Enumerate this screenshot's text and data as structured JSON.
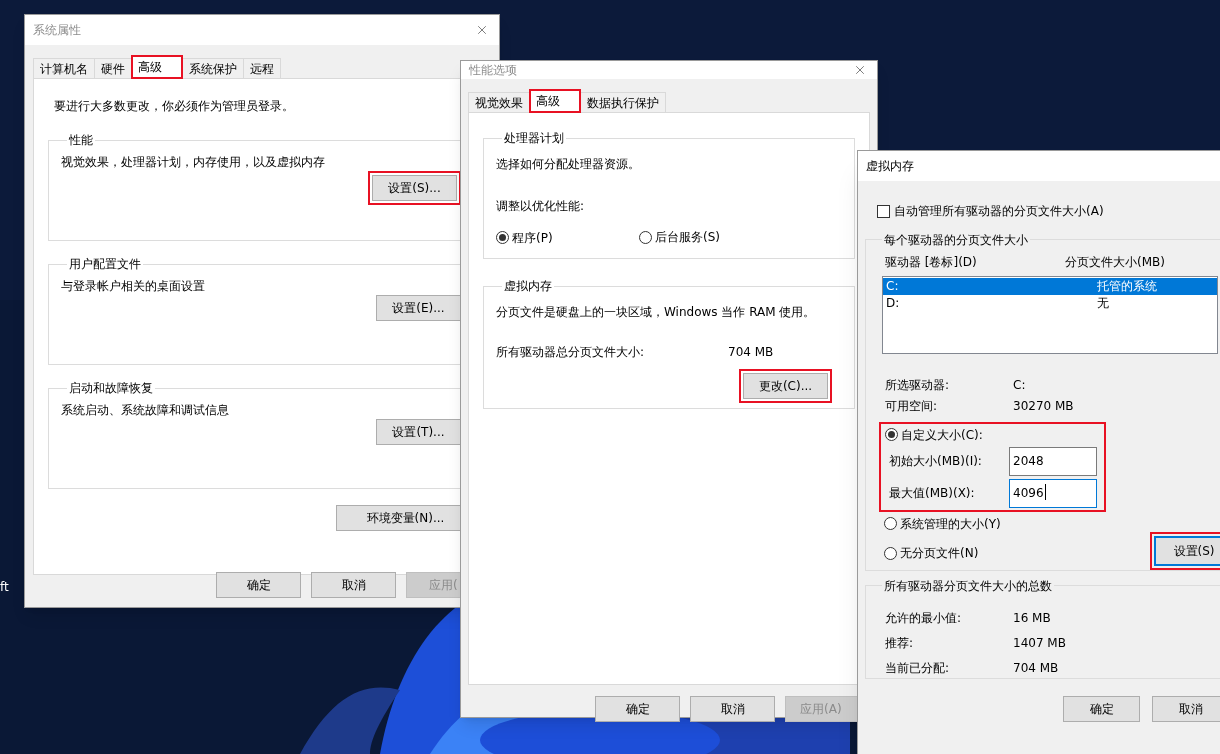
{
  "desktop": {
    "icon_label": "ft"
  },
  "system_properties": {
    "title": "系统属性",
    "close_button": true,
    "tabs": [
      {
        "label": "计算机名",
        "selected": false,
        "highlighted": false
      },
      {
        "label": "硬件",
        "selected": false,
        "highlighted": false
      },
      {
        "label": "高级",
        "selected": true,
        "highlighted": true
      },
      {
        "label": "系统保护",
        "selected": false,
        "highlighted": false
      },
      {
        "label": "远程",
        "selected": false,
        "highlighted": false
      }
    ],
    "notice": "要进行大多数更改，你必须作为管理员登录。",
    "groups": [
      {
        "title": "性能",
        "description": "视觉效果，处理器计划，内存使用，以及虚拟内存",
        "button": {
          "label": "设置(S)...",
          "highlighted": true
        }
      },
      {
        "title": "用户配置文件",
        "description": "与登录帐户相关的桌面设置",
        "button": {
          "label": "设置(E)...",
          "highlighted": false
        }
      },
      {
        "title": "启动和故障恢复",
        "description": "系统启动、系统故障和调试信息",
        "button": {
          "label": "设置(T)...",
          "highlighted": false
        }
      }
    ],
    "env_button": "环境变量(N)...",
    "buttons": [
      {
        "label": "确定",
        "disabled": false
      },
      {
        "label": "取消",
        "disabled": false
      },
      {
        "label": "应用(",
        "disabled": true
      }
    ]
  },
  "performance_options": {
    "title": "性能选项",
    "close_button": true,
    "tabs": [
      {
        "label": "视觉效果",
        "selected": false,
        "highlighted": false
      },
      {
        "label": "高级",
        "selected": true,
        "highlighted": true
      },
      {
        "label": "数据执行保护",
        "selected": false,
        "highlighted": false
      }
    ],
    "processor_group": {
      "title": "处理器计划",
      "description": "选择如何分配处理器资源。",
      "prompt": "调整以优化性能:",
      "options": [
        {
          "label": "程序(P)",
          "selected": true
        },
        {
          "label": "后台服务(S)",
          "selected": false
        }
      ]
    },
    "vm_group": {
      "title": "虚拟内存",
      "description": "分页文件是硬盘上的一块区域，Windows 当作 RAM 使用。",
      "total_label": "所有驱动器总分页文件大小:",
      "total_value": "704 MB",
      "button": {
        "label": "更改(C)...",
        "highlighted": true
      }
    },
    "buttons": [
      {
        "label": "确定",
        "disabled": false
      },
      {
        "label": "取消",
        "disabled": false
      },
      {
        "label": "应用(A)",
        "disabled": true
      }
    ]
  },
  "virtual_memory": {
    "title": "虚拟内存",
    "close_button": false,
    "auto_manage": {
      "label": "自动管理所有驱动器的分页文件大小(A)",
      "checked": false
    },
    "drives_group": {
      "title": "每个驱动器的分页文件大小",
      "columns": [
        "驱动器 [卷标](D)",
        "分页文件大小(MB)"
      ],
      "rows": [
        {
          "drive": "C:",
          "size": "托管的系统",
          "selected": true
        },
        {
          "drive": "D:",
          "size": "无",
          "selected": false
        }
      ],
      "info": [
        {
          "label": "所选驱动器:",
          "value": "C:"
        },
        {
          "label": "可用空间:",
          "value": "30270 MB"
        }
      ],
      "custom": {
        "label": "自定义大小(C):",
        "selected": true,
        "highlighted": true,
        "fields": [
          {
            "label": "初始大小(MB)(I):",
            "value": "2048",
            "focused": false
          },
          {
            "label": "最大值(MB)(X):",
            "value": "4096",
            "focused": true
          }
        ]
      },
      "options": [
        {
          "label": "系统管理的大小(Y)",
          "selected": false
        },
        {
          "label": "无分页文件(N)",
          "selected": false
        }
      ],
      "set_button": {
        "label": "设置(S)",
        "highlighted": true,
        "focused": true
      }
    },
    "totals_group": {
      "title": "所有驱动器分页文件大小的总数",
      "rows": [
        {
          "label": "允许的最小值:",
          "value": "16 MB"
        },
        {
          "label": "推荐:",
          "value": "1407 MB"
        },
        {
          "label": "当前已分配:",
          "value": "704 MB"
        }
      ]
    },
    "buttons": [
      {
        "label": "确定",
        "disabled": false
      },
      {
        "label": "取消",
        "disabled": false
      }
    ]
  }
}
